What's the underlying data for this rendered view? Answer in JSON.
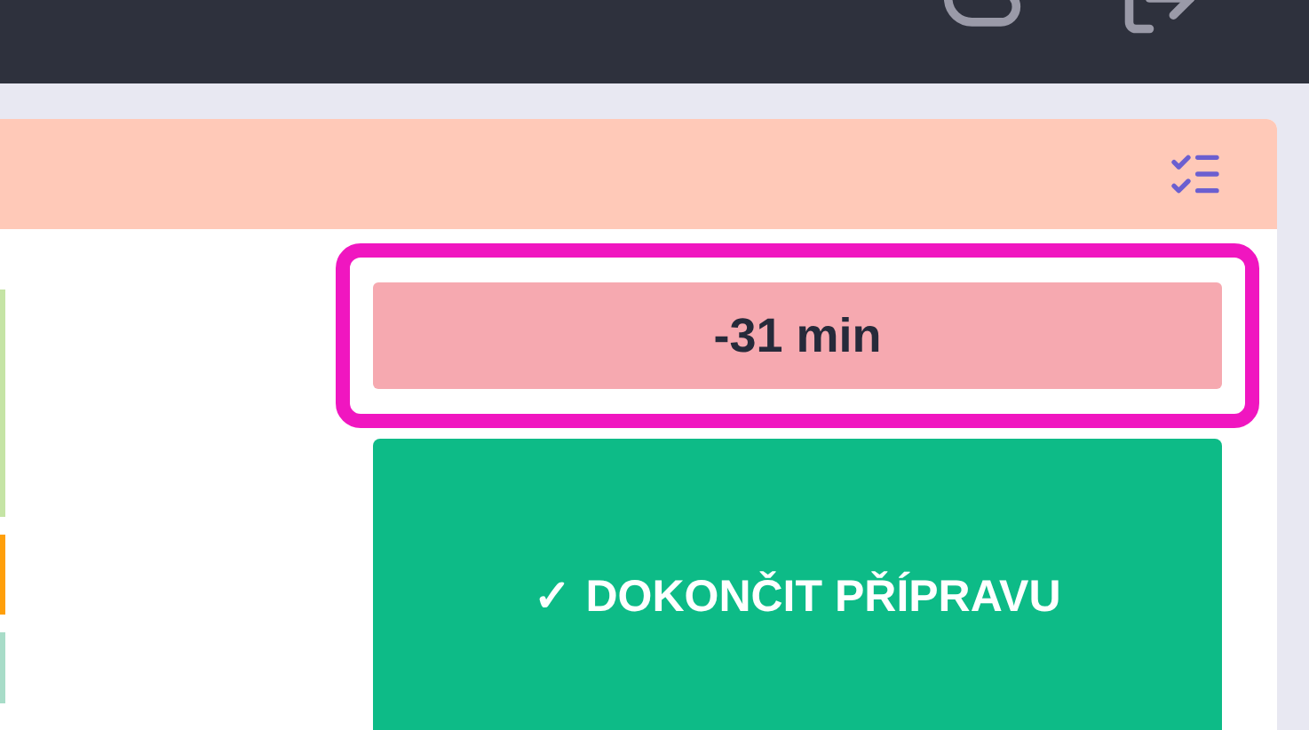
{
  "card": {
    "timer": "-31 min",
    "finish_button": {
      "icon": "✓",
      "label": "DOKONČIT PŘÍPRAVU"
    },
    "side_strips": [
      {
        "color": "#c5e4a5"
      },
      {
        "color": "#ff9f0a"
      },
      {
        "color": "#a8dcc8"
      }
    ]
  }
}
